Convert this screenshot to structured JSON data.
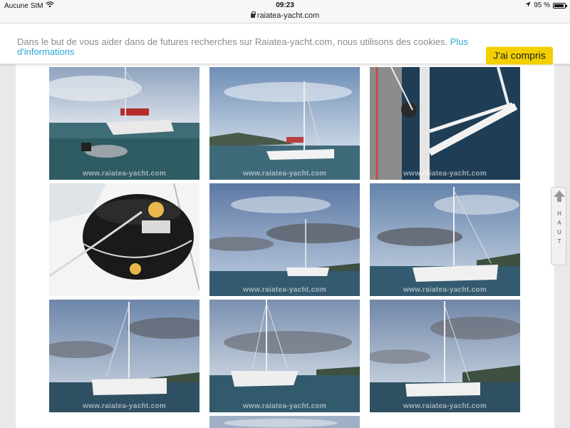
{
  "status_bar": {
    "carrier": "Aucune SIM",
    "time": "09:23",
    "battery_text": "95 %",
    "battery_level": 0.95,
    "icons": [
      "wifi-icon",
      "location-arrow-icon",
      "battery-icon"
    ]
  },
  "browser": {
    "url": "raiatea-yacht.com",
    "icons": [
      "lock-icon"
    ]
  },
  "cookie_banner": {
    "text": "Dans le but de vous aider dans de futures recherches sur Raiatea-yacht.com, nous utilisons des cookies. ",
    "link_text": "Plus d'informations",
    "button_label": "J'ai compris",
    "button_color": "#f2d000",
    "link_color": "#2aa6d6"
  },
  "gallery": {
    "watermark": "www.raiatea-yacht.com",
    "photos": [
      {
        "subject": "catamaran-with-dinghy"
      },
      {
        "subject": "catamaran-near-island"
      },
      {
        "subject": "mast-fitting-closeup"
      },
      {
        "subject": "sail-bag-on-deck"
      },
      {
        "subject": "catamaran-far-cloudy"
      },
      {
        "subject": "catamaran-side-cloudy"
      },
      {
        "subject": "catamaran-stern-view"
      },
      {
        "subject": "catamaran-front-view"
      },
      {
        "subject": "catamaran-anchored"
      },
      {
        "subject": "partial-photo"
      }
    ]
  },
  "scroll_top": {
    "letters": [
      "H",
      "A",
      "U",
      "T"
    ],
    "icons": [
      "up-arrow-icon"
    ]
  }
}
